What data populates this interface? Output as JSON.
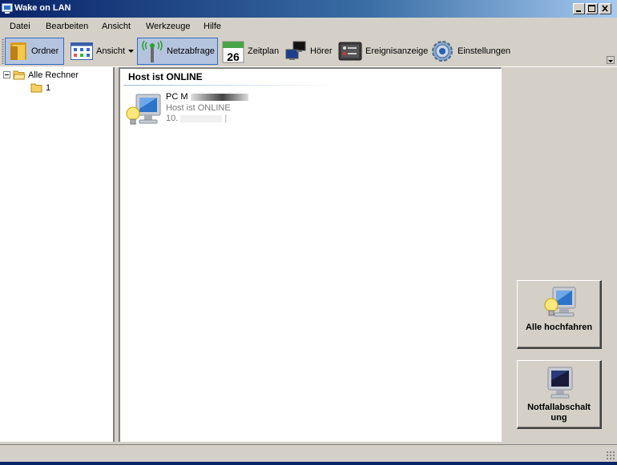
{
  "window": {
    "title": "Wake on LAN"
  },
  "menu": [
    "Datei",
    "Bearbeiten",
    "Ansicht",
    "Werkzeuge",
    "Hilfe"
  ],
  "toolbar": {
    "ordner": "Ordner",
    "ansicht": "Ansicht",
    "netzabfrage": "Netzabfrage",
    "zeitplan": "Zeitplan",
    "calendar_day": "26",
    "hoerer": "Hörer",
    "ereignisanzeige": "Ereignisanzeige",
    "einstellungen": "Einstellungen"
  },
  "tree": {
    "root": "Alle Rechner",
    "child": "1"
  },
  "group": {
    "header": "Host ist ONLINE"
  },
  "host": {
    "name": "PC M",
    "status": "Host ist ONLINE",
    "ip": "10."
  },
  "actions": {
    "wake_all_line1": "Alle hochfahren",
    "emergency_line1": "Notfallabschalt",
    "emergency_line2": "ung"
  }
}
